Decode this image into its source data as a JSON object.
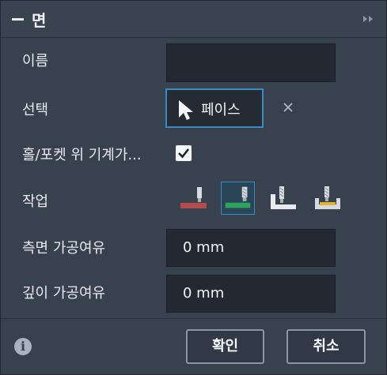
{
  "title": "면",
  "labels": {
    "name": "이름",
    "select": "선택",
    "machining": "홀/포켓 위 기계가...",
    "operation": "작업",
    "side_allowance": "측면 가공여유",
    "depth_allowance": "깊이 가공여유"
  },
  "name_value": "",
  "select_button_label": "페이스",
  "machining_checked": true,
  "operation_options": [
    "operation-1",
    "operation-2",
    "operation-3",
    "operation-4"
  ],
  "operation_selected_index": 1,
  "side_allowance_value": "0 mm",
  "depth_allowance_value": "0 mm",
  "buttons": {
    "ok": "확인",
    "cancel": "취소"
  },
  "icons": {
    "collapse": "minus-icon",
    "expand": "double-chevron-right-icon",
    "cursor": "cursor-arrow-icon",
    "clear": "close-icon",
    "check": "checkmark-icon",
    "info": "info-icon"
  },
  "colors": {
    "accent": "#3d8ac2",
    "panel": "#38414e",
    "field": "#222933"
  }
}
